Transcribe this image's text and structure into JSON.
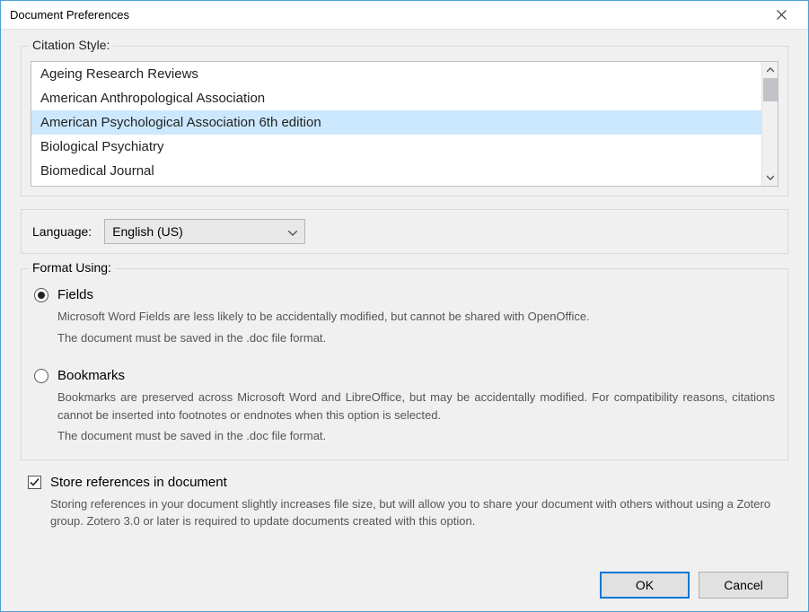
{
  "window": {
    "title": "Document Preferences"
  },
  "citation": {
    "legend": "Citation Style:",
    "items": [
      "Ageing Research Reviews",
      "American Anthropological Association",
      "American Psychological Association 6th edition",
      "Biological Psychiatry",
      "Biomedical Journal"
    ],
    "selected_index": 2
  },
  "language": {
    "label": "Language:",
    "value": "English (US)"
  },
  "format": {
    "legend": "Format Using:",
    "options": [
      {
        "label": "Fields",
        "checked": true,
        "desc1": "Microsoft Word Fields are less likely to be accidentally modified, but cannot be shared with OpenOffice.",
        "desc2": "The document must be saved in the .doc file format."
      },
      {
        "label": "Bookmarks",
        "checked": false,
        "desc1": "Bookmarks are preserved across Microsoft Word and LibreOffice, but may be accidentally modified. For compatibility reasons, citations cannot be inserted into footnotes or endnotes when this option is selected.",
        "desc2": "The document must be saved in the .doc file format."
      }
    ]
  },
  "store": {
    "label": "Store references in document",
    "checked": true,
    "desc": "Storing references in your document slightly increases file size, but will allow you to share your document with others without using a Zotero group. Zotero 3.0 or later is required to update documents created with this option."
  },
  "buttons": {
    "ok": "OK",
    "cancel": "Cancel"
  }
}
